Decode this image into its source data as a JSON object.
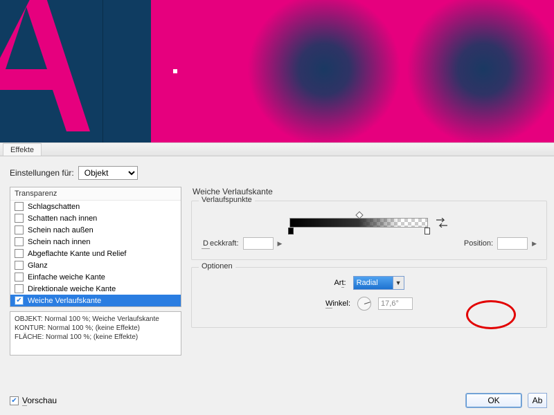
{
  "tab_title": "Effekte",
  "settings_label": "Einstellungen für:",
  "settings_value": "Objekt",
  "panel_title": "Weiche Verlaufskante",
  "transparenz_header": "Transparenz",
  "effects": [
    {
      "label": "Schlagschatten",
      "checked": false
    },
    {
      "label": "Schatten nach innen",
      "checked": false
    },
    {
      "label": "Schein nach außen",
      "checked": false
    },
    {
      "label": "Schein nach innen",
      "checked": false
    },
    {
      "label": "Abgeflachte Kante und Relief",
      "checked": false
    },
    {
      "label": "Glanz",
      "checked": false
    },
    {
      "label": "Einfache weiche Kante",
      "checked": false
    },
    {
      "label": "Direktionale weiche Kante",
      "checked": false
    },
    {
      "label": "Weiche Verlaufskante",
      "checked": true
    }
  ],
  "summary": "OBJEKT: Normal 100 %; Weiche Verlaufskante\nKONTUR: Normal 100 %; (keine Effekte)\nFLÄCHE: Normal 100 %; (keine Effekte)",
  "gradient": {
    "legend": "Verlaufspunkte",
    "deckkraft_label": "Deckkraft:",
    "deckkraft_value": "",
    "position_label": "Position:",
    "position_value": ""
  },
  "options": {
    "legend": "Optionen",
    "art_label": "Art:",
    "art_value": "Radial",
    "winkel_label": "Winkel:",
    "winkel_value": "17,6°"
  },
  "vorschau_label": "Vorschau",
  "ok_label": "OK",
  "cancel_label": "Ab"
}
